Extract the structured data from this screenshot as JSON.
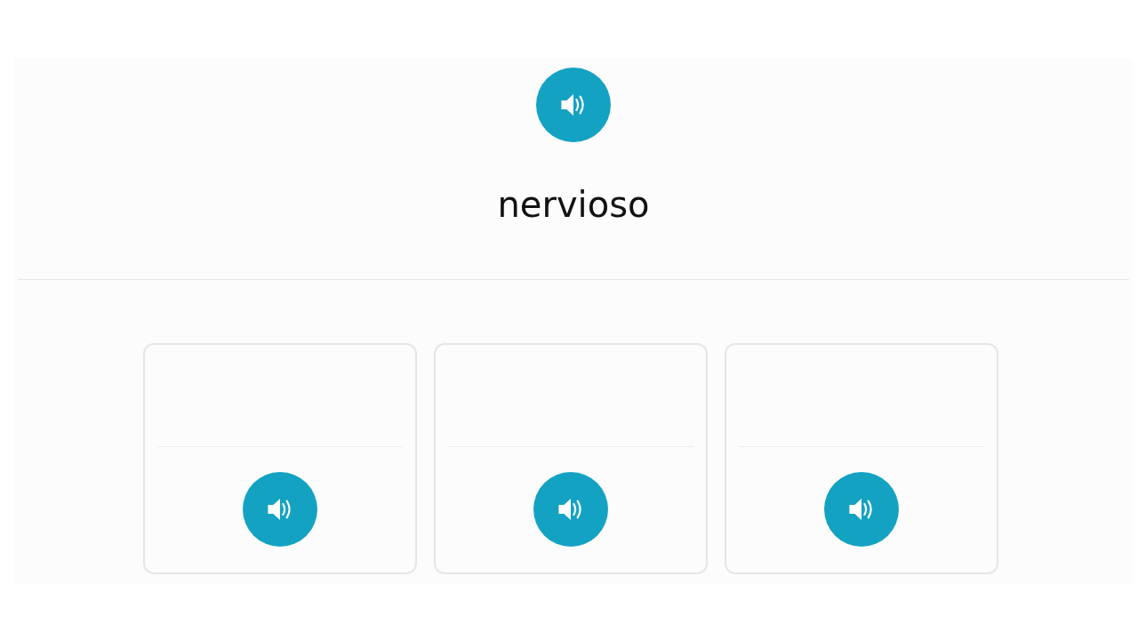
{
  "prompt": {
    "kind": "audio",
    "word": "nervioso"
  },
  "options": [
    {
      "kind": "audio"
    },
    {
      "kind": "audio"
    },
    {
      "kind": "audio"
    }
  ]
}
